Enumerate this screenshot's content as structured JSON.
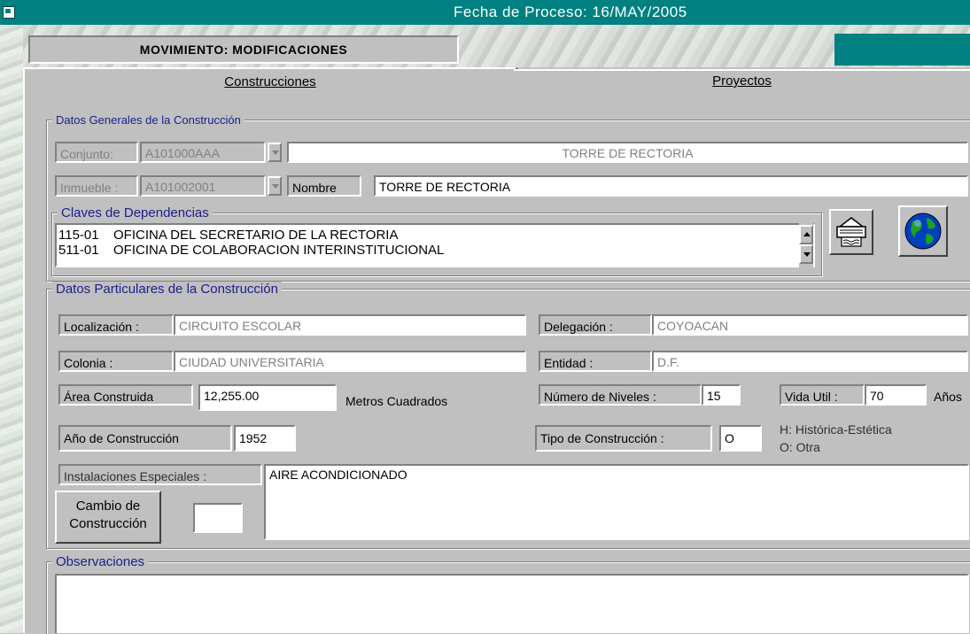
{
  "titlebar": {
    "title": "Fecha de Proceso: 16/MAY/2005",
    "icon": "app-icon"
  },
  "header": {
    "movimiento": "MOVIMIENTO: MODIFICACIONES"
  },
  "tabs": [
    {
      "label": "Construcciones",
      "active": true
    },
    {
      "label": "Proyectos",
      "active": false
    }
  ],
  "datos_generales": {
    "legend": "Datos Generales de la Construcción",
    "conjunto_label": "Conjunto:",
    "conjunto_value": "A101000AAA",
    "conjunto_desc": "TORRE DE RECTORIA",
    "inmueble_label": "Inmueble :",
    "inmueble_value": "A101002001",
    "nombre_label": "Nombre",
    "nombre_value": "TORRE DE RECTORIA",
    "claves": {
      "legend": "Claves de Dependencias",
      "items": [
        {
          "code": "115-01",
          "name": "OFICINA DEL SECRETARIO DE LA RECTORIA"
        },
        {
          "code": "511-01",
          "name": "OFICINA DE COLABORACION INTERINSTITUCIONAL"
        }
      ]
    },
    "icons": {
      "print": "printer-icon",
      "globe": "globe-icon"
    }
  },
  "datos_particulares": {
    "legend": "Datos Particulares de la Construcción",
    "localizacion_label": "Localización :",
    "localizacion_value": "CIRCUITO ESCOLAR",
    "delegacion_label": "Delegación :",
    "delegacion_value": "COYOACAN",
    "colonia_label": "Colonia :",
    "colonia_value": "CIUDAD UNIVERSITARIA",
    "entidad_label": "Entidad :",
    "entidad_value": "D.F.",
    "area_label": "Área Construida",
    "area_value": "12,255.00",
    "area_unit": "Metros Cuadrados",
    "niveles_label": "Número de Niveles :",
    "niveles_value": "15",
    "vida_label": "Vida Util :",
    "vida_value": "70",
    "vida_unit": "Años",
    "anio_label": "Año de Construcción",
    "anio_value": "1952",
    "tipo_label": "Tipo de Construcción :",
    "tipo_value": "O",
    "tipo_legend_1": "H: Histórica-Estética",
    "tipo_legend_2": "O: Otra",
    "instalaciones_label": "Instalaciones Especiales :",
    "instalaciones_value": "AIRE ACONDICIONADO",
    "cambio_label_1": "Cambio de",
    "cambio_label_2": "Construcción",
    "cambio_value": ""
  },
  "observaciones": {
    "legend": "Observaciones",
    "value": ""
  }
}
